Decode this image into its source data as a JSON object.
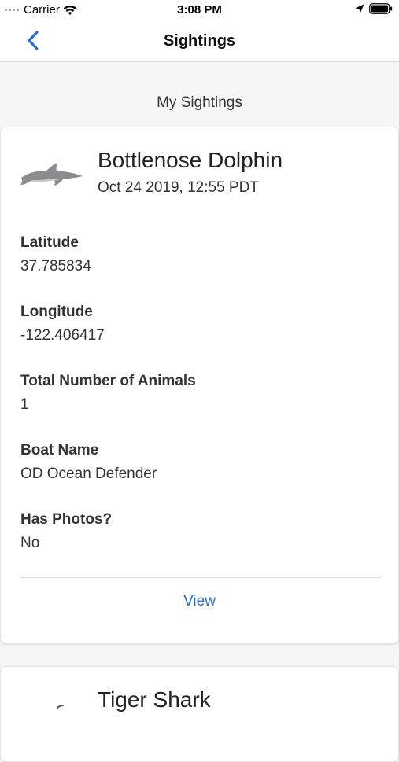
{
  "status_bar": {
    "carrier": "Carrier",
    "time": "3:08 PM"
  },
  "nav": {
    "title": "Sightings"
  },
  "section": {
    "heading": "My Sightings"
  },
  "sightings": [
    {
      "species": "Bottlenose Dolphin",
      "date": "Oct 24 2019, 12:55 PDT",
      "fields": [
        {
          "label": "Latitude",
          "value": "37.785834"
        },
        {
          "label": "Longitude",
          "value": "-122.406417"
        },
        {
          "label": "Total Number of Animals",
          "value": "1"
        },
        {
          "label": "Boat Name",
          "value": "OD Ocean Defender"
        },
        {
          "label": "Has Photos?",
          "value": "No"
        }
      ],
      "action_label": "View",
      "icon": "dolphin-icon"
    },
    {
      "species": "Tiger Shark",
      "icon": "shark-icon"
    }
  ],
  "colors": {
    "accent": "#2b6ccf",
    "background": "#f5f5f7",
    "card": "#ffffff"
  }
}
